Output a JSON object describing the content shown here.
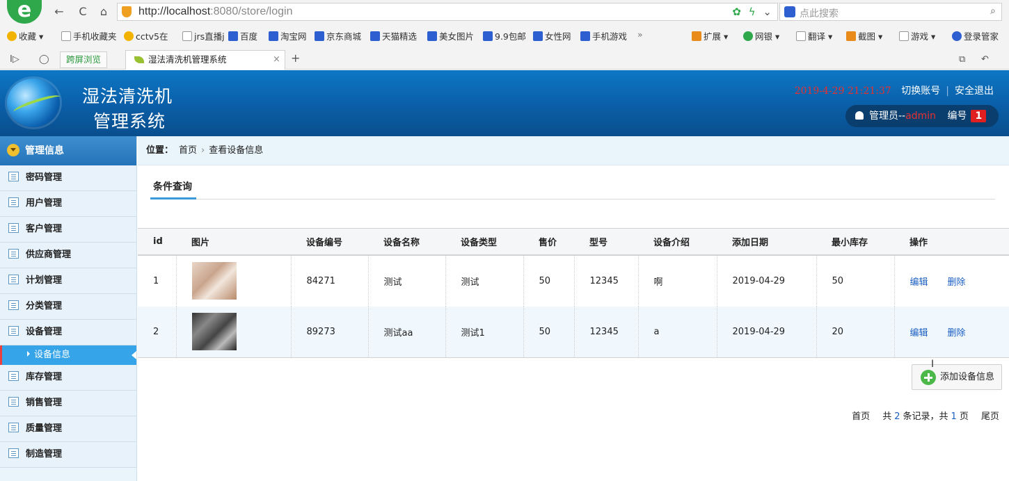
{
  "browser": {
    "url_host": "http://localhost",
    "url_rest": ":8080/store/login",
    "search_placeholder": "点此搜索",
    "bookmarks": [
      "收藏",
      "手机收藏夹",
      "cctv5在",
      "jrs直播j",
      "百度",
      "淘宝网",
      "京东商城",
      "天猫精选",
      "美女图片",
      "9.9包邮",
      "女性网",
      "手机游戏"
    ],
    "bookmark_overflow": "»",
    "tools": [
      "扩展",
      "网银",
      "翻译",
      "截图",
      "游戏",
      "登录管家"
    ],
    "tab_cross": "跨屏浏览",
    "tab_active": "湿法清洗机管理系统"
  },
  "header": {
    "title_line1": "湿法清洗机",
    "title_line2": "管理系统",
    "datetime": "2019-4-29 21:21:37",
    "switch_account": "切换账号",
    "logout": "安全退出",
    "user_prefix": "管理员--",
    "user_name": "admin",
    "number_label": "编号",
    "number_value": "1"
  },
  "sidebar": {
    "head": "管理信息",
    "items": [
      {
        "label": "密码管理"
      },
      {
        "label": "用户管理"
      },
      {
        "label": "客户管理"
      },
      {
        "label": "供应商管理"
      },
      {
        "label": "计划管理"
      },
      {
        "label": "分类管理"
      },
      {
        "label": "设备管理"
      },
      {
        "label": "库存管理"
      },
      {
        "label": "销售管理"
      },
      {
        "label": "质量管理"
      },
      {
        "label": "制造管理"
      }
    ],
    "active_sub": "设备信息"
  },
  "breadcrumb": {
    "label": "位置：",
    "home": "首页",
    "current": "查看设备信息"
  },
  "filter": {
    "tab": "条件查询"
  },
  "table": {
    "headers": [
      "id",
      "图片",
      "设备编号",
      "设备名称",
      "设备类型",
      "售价",
      "型号",
      "设备介绍",
      "添加日期",
      "最小库存",
      "操作"
    ],
    "rows": [
      {
        "id": "1",
        "code": "84271",
        "name": "测试",
        "type": "测试",
        "price": "50",
        "model": "12345",
        "intro": "啊",
        "date": "2019-04-29",
        "min_stock": "50"
      },
      {
        "id": "2",
        "code": "89273",
        "name": "测试aa",
        "type": "测试1",
        "price": "50",
        "model": "12345",
        "intro": "a",
        "date": "2019-04-29",
        "min_stock": "20"
      }
    ],
    "edit_label": "编辑",
    "delete_label": "删除"
  },
  "actions": {
    "add_device": "添加设备信息"
  },
  "pager": {
    "first": "首页",
    "total_prefix": "共",
    "total_count": "2",
    "total_mid": "条记录，共",
    "page_count": "1",
    "page_suffix": "页",
    "last": "尾页"
  }
}
